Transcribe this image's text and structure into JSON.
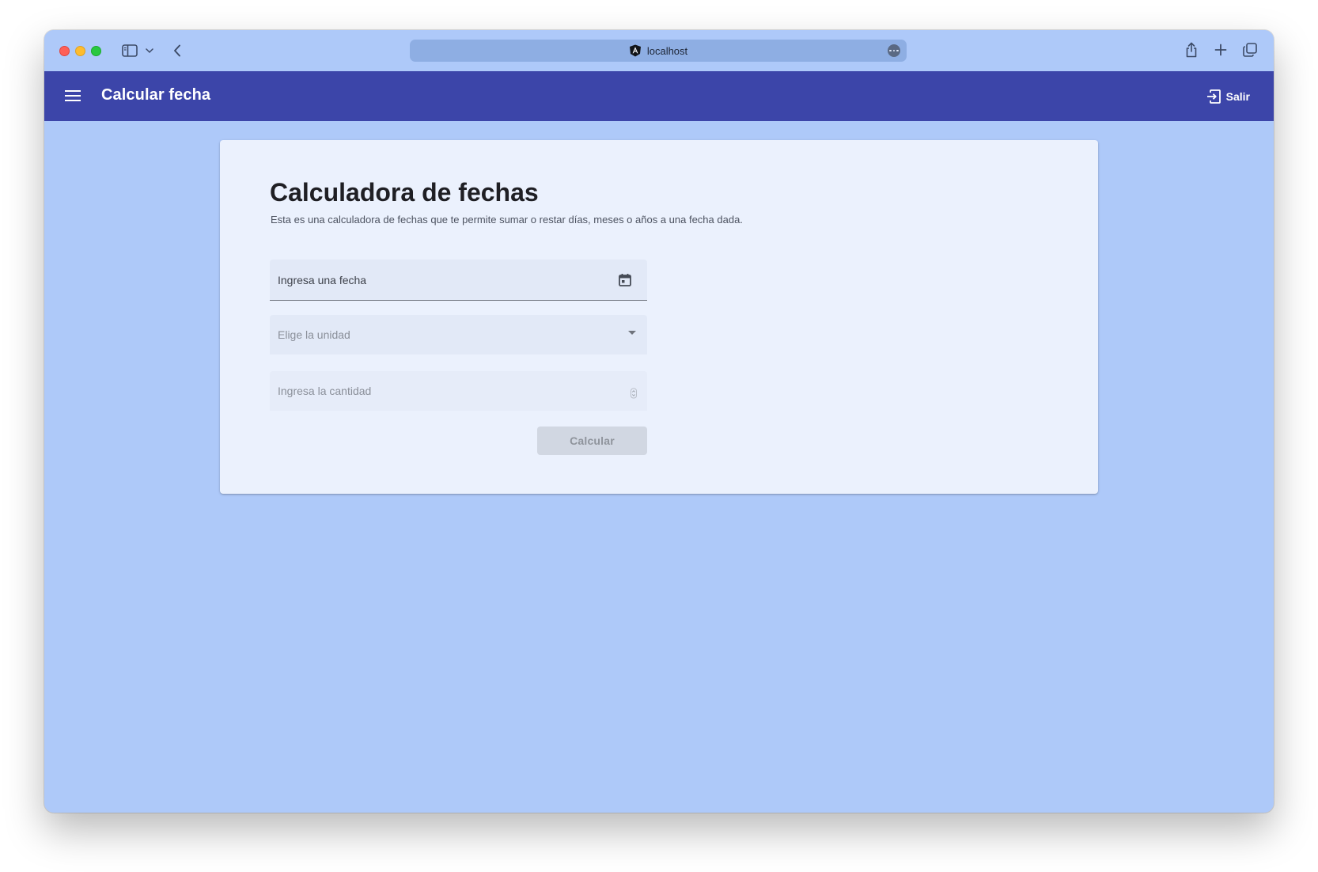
{
  "browser": {
    "url": "localhost"
  },
  "toolbar": {
    "title": "Calcular fecha",
    "logout_label": "Salir"
  },
  "card": {
    "title": "Calculadora de fechas",
    "description": "Esta es una calculadora de fechas que te permite sumar o restar días, meses o años a una fecha dada."
  },
  "form": {
    "date_label": "Ingresa una fecha",
    "unit_label": "Elige la unidad",
    "quantity_label": "Ingresa la cantidad",
    "submit_label": "Calcular",
    "submit_disabled": true
  },
  "icons": {
    "menu": "menu-icon",
    "logout": "logout-icon",
    "calendar": "calendar-icon",
    "dropdown": "dropdown-arrow-icon",
    "spinner": "number-spinner-icon",
    "site": "angular-icon"
  },
  "colors": {
    "toolbar": "#3c45a9",
    "page_background": "#aec9f9",
    "card_background": "#ebf1fd",
    "disabled_button": "#d1d7e2"
  }
}
